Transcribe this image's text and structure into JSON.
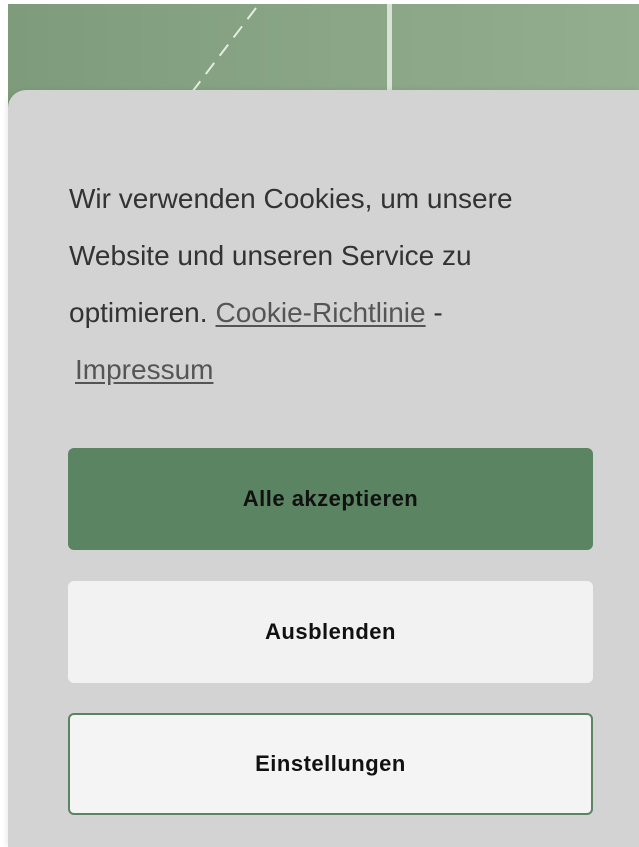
{
  "cookie_banner": {
    "message": "Wir verwenden Cookies, um unsere Website und unseren Service zu optimieren.",
    "policy_link": "Cookie-Richtlinie",
    "separator": "-",
    "imprint_link": "Impressum",
    "buttons": {
      "accept_all": "Alle akzeptieren",
      "hide": "Ausblenden",
      "settings": "Einstellungen"
    }
  },
  "colors": {
    "accent": "#5a8462",
    "dialog_background": "#d3d3d3",
    "backdrop": "#8aa686"
  }
}
